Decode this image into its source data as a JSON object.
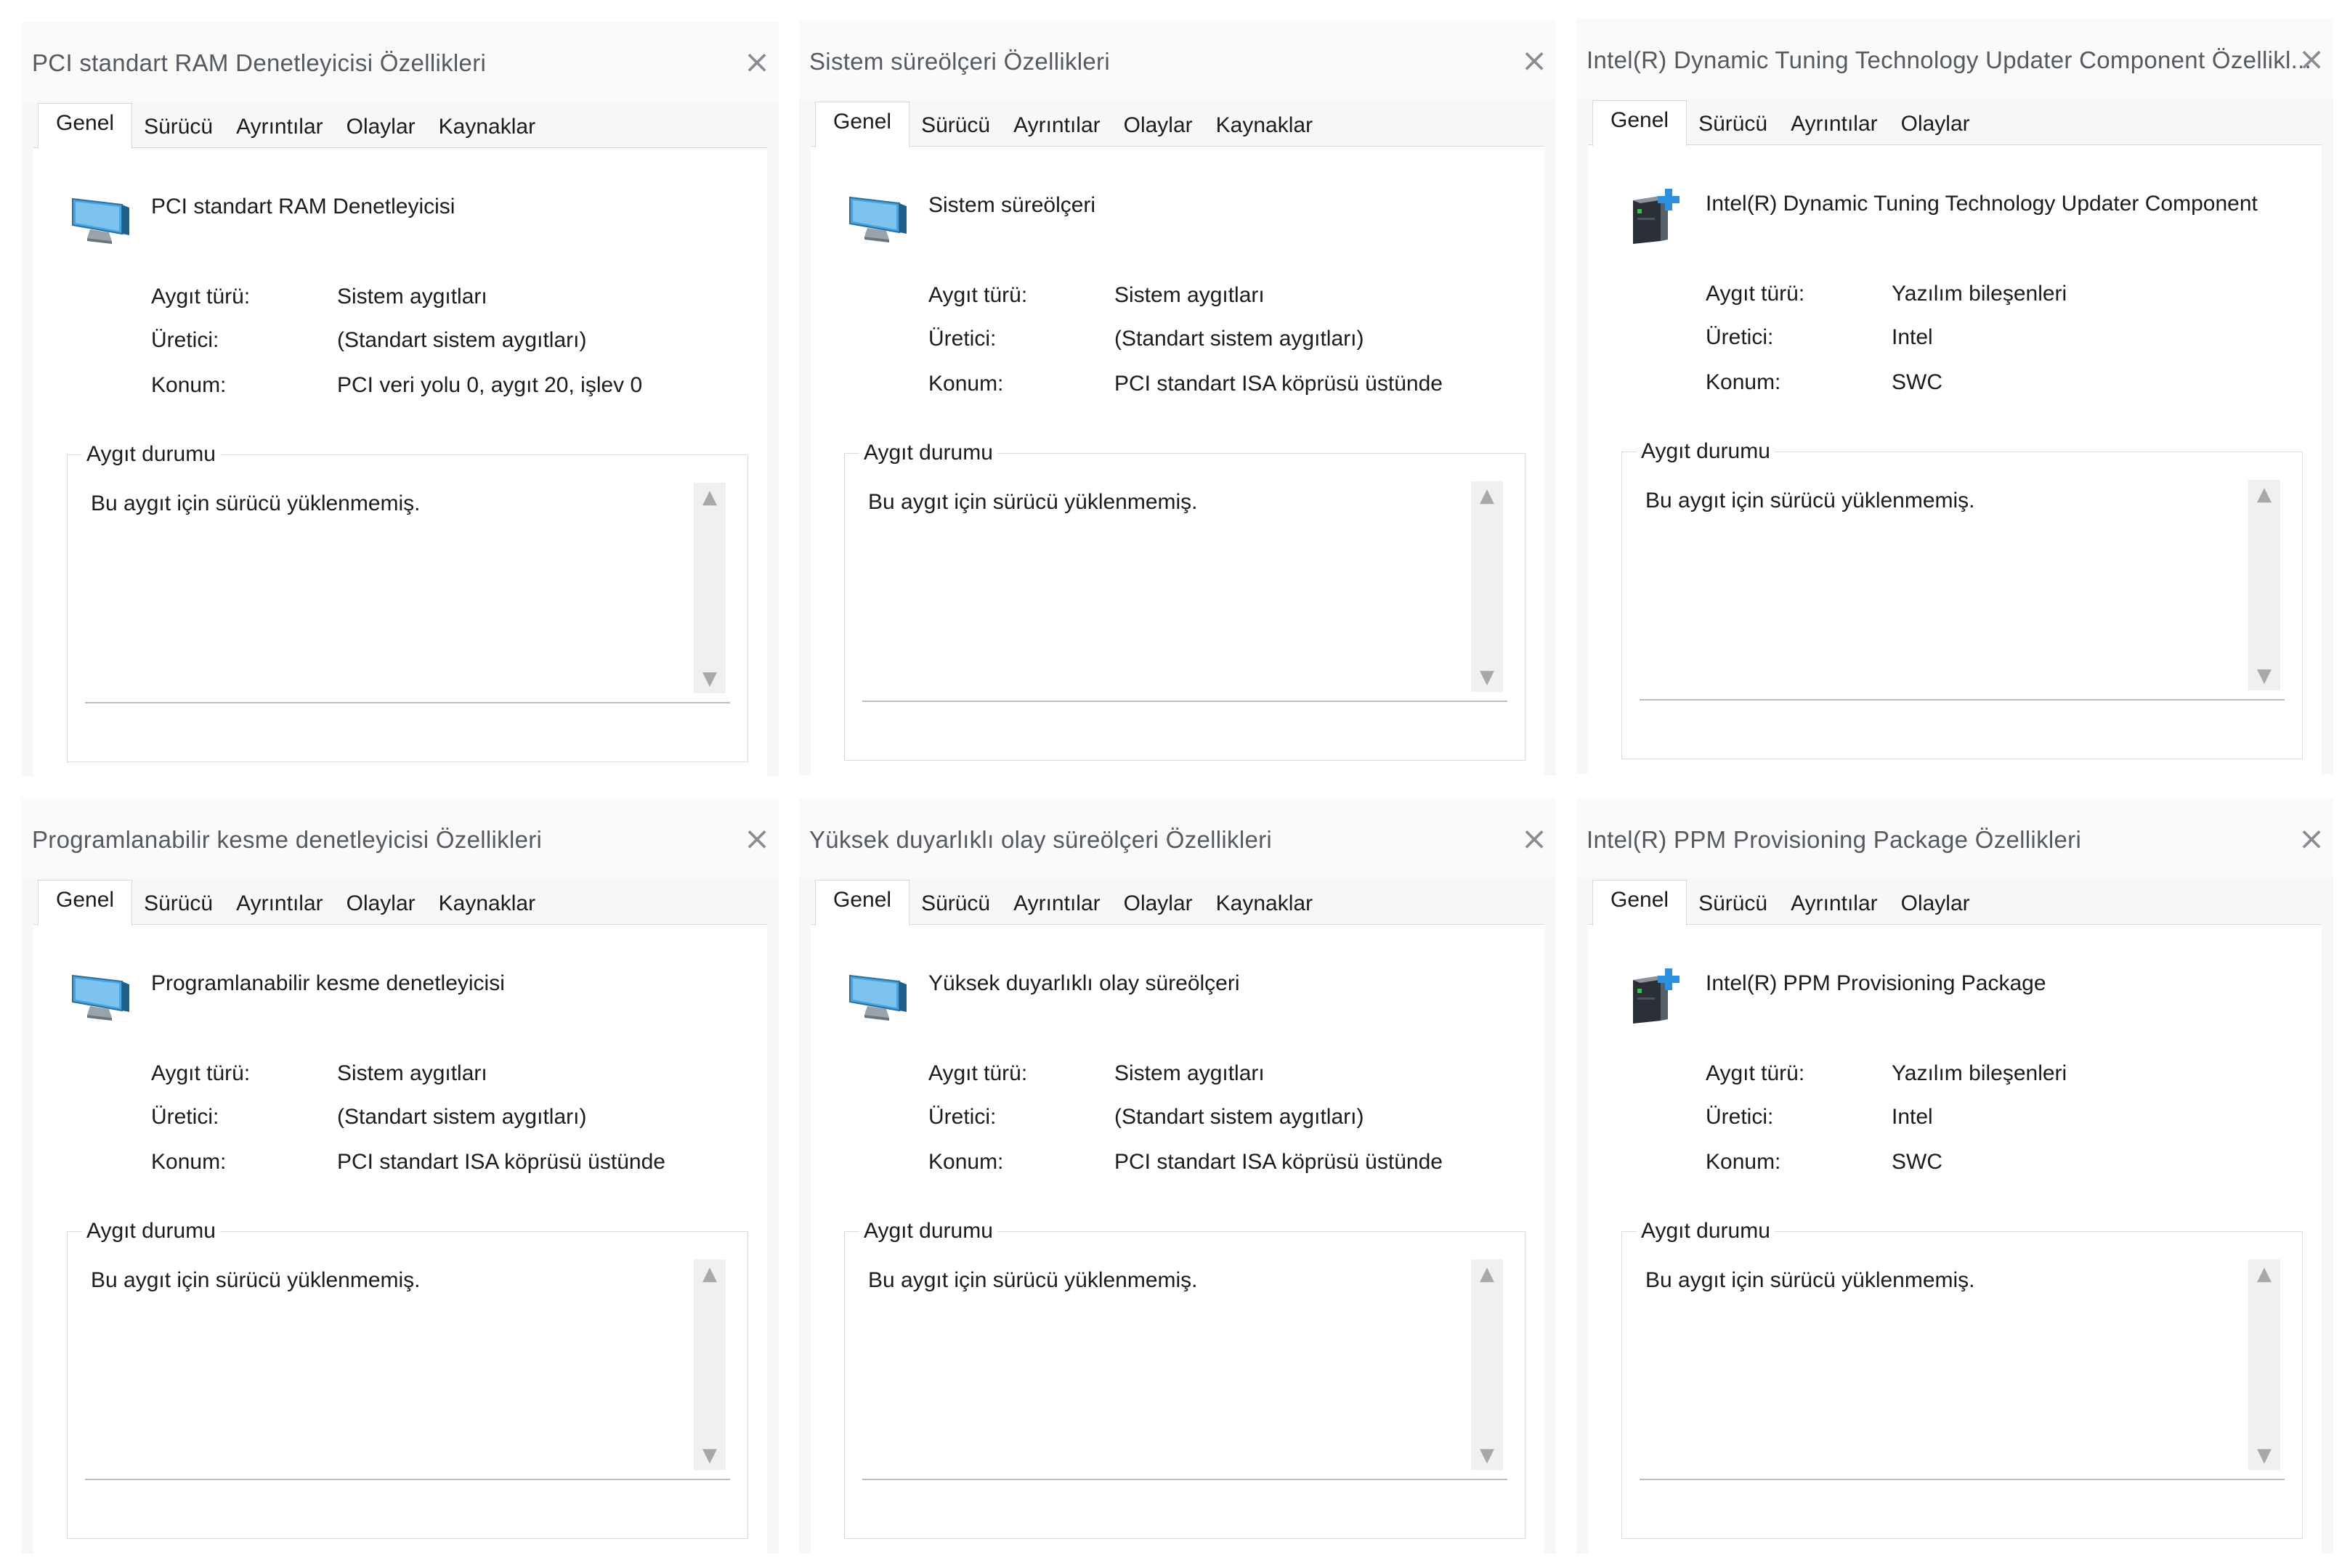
{
  "dialogs": [
    {
      "title": "PCI standart RAM Denetleyicisi Özellikleri",
      "tabs": [
        "Genel",
        "Sürücü",
        "Ayrıntılar",
        "Olaylar",
        "Kaynaklar"
      ],
      "device_name": "PCI standart RAM Denetleyicisi",
      "icon": "monitor-icon",
      "properties": {
        "type_label": "Aygıt türü:",
        "type_value": "Sistem aygıtları",
        "manufacturer_label": "Üretici:",
        "manufacturer_value": "(Standart sistem aygıtları)",
        "location_label": "Konum:",
        "location_value": "PCI veri yolu 0, aygıt 20, işlev 0"
      },
      "status_legend": "Aygıt durumu",
      "status_text": "Bu aygıt için sürücü yüklenmemiş.",
      "close": "×",
      "scroll_up": "▲",
      "scroll_down": "▼"
    },
    {
      "title": "Sistem süreölçeri Özellikleri",
      "tabs": [
        "Genel",
        "Sürücü",
        "Ayrıntılar",
        "Olaylar",
        "Kaynaklar"
      ],
      "device_name": "Sistem süreölçeri",
      "icon": "monitor-icon",
      "properties": {
        "type_label": "Aygıt türü:",
        "type_value": "Sistem aygıtları",
        "manufacturer_label": "Üretici:",
        "manufacturer_value": "(Standart sistem aygıtları)",
        "location_label": "Konum:",
        "location_value": "PCI standart ISA köprüsü üstünde"
      },
      "status_legend": "Aygıt durumu",
      "status_text": "Bu aygıt için sürücü yüklenmemiş.",
      "close": "×",
      "scroll_up": "▲",
      "scroll_down": "▼"
    },
    {
      "title": "Intel(R) Dynamic Tuning Technology Updater Component Özellikl...",
      "tabs": [
        "Genel",
        "Sürücü",
        "Ayrıntılar",
        "Olaylar"
      ],
      "device_name": "Intel(R) Dynamic Tuning Technology Updater Component",
      "icon": "software-component-icon",
      "properties": {
        "type_label": "Aygıt türü:",
        "type_value": "Yazılım bileşenleri",
        "manufacturer_label": "Üretici:",
        "manufacturer_value": "Intel",
        "location_label": "Konum:",
        "location_value": "SWC"
      },
      "status_legend": "Aygıt durumu",
      "status_text": "Bu aygıt için sürücü yüklenmemiş.",
      "close": "×",
      "scroll_up": "▲",
      "scroll_down": "▼"
    },
    {
      "title": "Programlanabilir kesme denetleyicisi Özellikleri",
      "tabs": [
        "Genel",
        "Sürücü",
        "Ayrıntılar",
        "Olaylar",
        "Kaynaklar"
      ],
      "device_name": "Programlanabilir kesme denetleyicisi",
      "icon": "monitor-icon",
      "properties": {
        "type_label": "Aygıt türü:",
        "type_value": "Sistem aygıtları",
        "manufacturer_label": "Üretici:",
        "manufacturer_value": "(Standart sistem aygıtları)",
        "location_label": "Konum:",
        "location_value": "PCI standart ISA köprüsü üstünde"
      },
      "status_legend": "Aygıt durumu",
      "status_text": "Bu aygıt için sürücü yüklenmemiş.",
      "close": "×",
      "scroll_up": "▲",
      "scroll_down": "▼"
    },
    {
      "title": "Yüksek duyarlıklı olay süreölçeri Özellikleri",
      "tabs": [
        "Genel",
        "Sürücü",
        "Ayrıntılar",
        "Olaylar",
        "Kaynaklar"
      ],
      "device_name": "Yüksek duyarlıklı olay süreölçeri",
      "icon": "monitor-icon",
      "properties": {
        "type_label": "Aygıt türü:",
        "type_value": "Sistem aygıtları",
        "manufacturer_label": "Üretici:",
        "manufacturer_value": "(Standart sistem aygıtları)",
        "location_label": "Konum:",
        "location_value": "PCI standart ISA köprüsü üstünde"
      },
      "status_legend": "Aygıt durumu",
      "status_text": "Bu aygıt için sürücü yüklenmemiş.",
      "close": "×",
      "scroll_up": "▲",
      "scroll_down": "▼"
    },
    {
      "title": "Intel(R) PPM Provisioning Package Özellikleri",
      "tabs": [
        "Genel",
        "Sürücü",
        "Ayrıntılar",
        "Olaylar"
      ],
      "device_name": "Intel(R) PPM Provisioning Package",
      "icon": "software-component-icon",
      "properties": {
        "type_label": "Aygıt türü:",
        "type_value": "Yazılım bileşenleri",
        "manufacturer_label": "Üretici:",
        "manufacturer_value": "Intel",
        "location_label": "Konum:",
        "location_value": "SWC"
      },
      "status_legend": "Aygıt durumu",
      "status_text": "Bu aygıt için sürücü yüklenmemiş.",
      "close": "×",
      "scroll_up": "▲",
      "scroll_down": "▼"
    }
  ],
  "colors": {
    "icon_screen": "#4aa3df",
    "icon_dark": "#2b2f36",
    "icon_led": "#36c24a",
    "icon_plus": "#2d8fe0"
  }
}
